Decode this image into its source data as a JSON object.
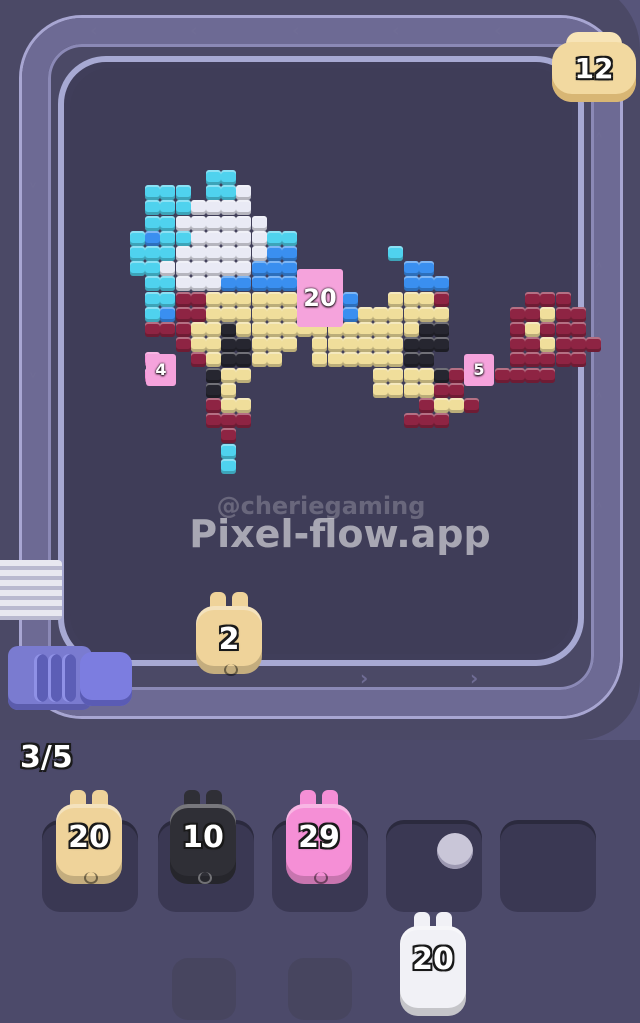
{
  "watermark": {
    "handle": "@cheriegaming",
    "site": "Pixel-flow.app"
  },
  "hud": {
    "queue_counter": "3/5",
    "fist_count": "12"
  },
  "board_tags": [
    {
      "id": "tag-blue",
      "label": "20"
    },
    {
      "id": "tag-left",
      "label": "4"
    },
    {
      "id": "tag-right",
      "label": "5"
    }
  ],
  "belt_piece": {
    "label": "2",
    "color": "beige"
  },
  "slots": [
    {
      "label": "20",
      "color": "beige"
    },
    {
      "label": "10",
      "color": "black"
    },
    {
      "label": "29",
      "color": "pink"
    },
    {
      "label": "",
      "color": "empty"
    },
    {
      "label": "",
      "color": "empty"
    }
  ],
  "incoming_piece": {
    "label": "20",
    "color": "white"
  },
  "colors": {
    "beige": "#efd39a",
    "black": "#2f2f36",
    "pink": "#f58fd6",
    "white": "#f1f1f6",
    "cyan": "#4fd2ee",
    "blue": "#3a8ff0",
    "maroon": "#8e2443",
    "cream": "#f0de9b",
    "dark": "#262630",
    "ghost": "#e9eaf5",
    "magenta": "#e85aa9"
  },
  "icons": {
    "fist": "fist-icon",
    "dispenser": "coil-dispenser-icon",
    "chevrons": "chevron-icon"
  }
}
